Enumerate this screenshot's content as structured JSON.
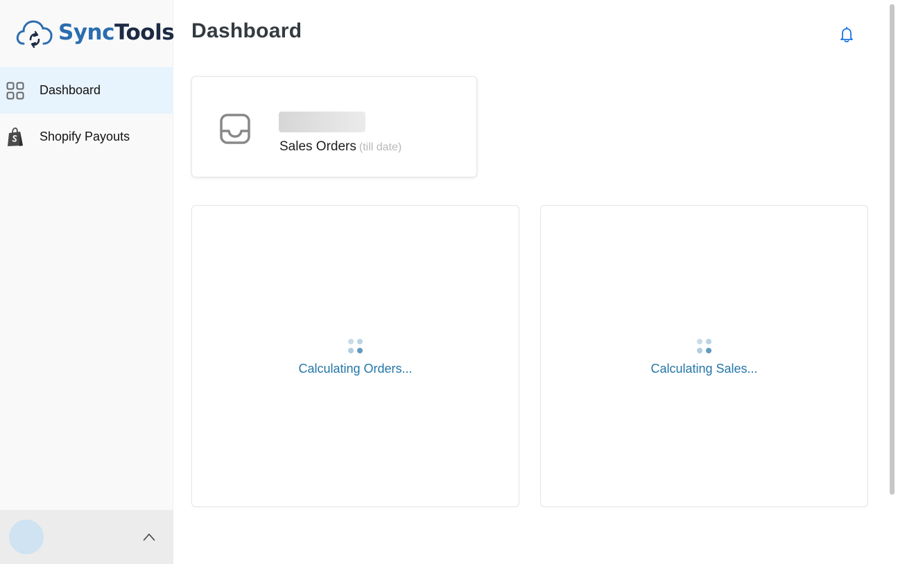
{
  "app": {
    "logo": {
      "text_sync": "Sync",
      "text_tools": "Tools",
      "icon": "cloud-sync-icon"
    }
  },
  "sidebar": {
    "items": [
      {
        "label": "Dashboard",
        "icon": "grid-icon",
        "active": true
      },
      {
        "label": "Shopify Payouts",
        "icon": "shopify-bag-icon",
        "active": false
      }
    ],
    "footer": {
      "avatar": "avatar",
      "toggle_icon": "chevron-up-icon"
    }
  },
  "header": {
    "title": "Dashboard",
    "notification_icon": "bell-icon"
  },
  "stats": {
    "sales_orders": {
      "icon": "inbox-icon",
      "label": "Sales Orders",
      "sub_label": "(till date)"
    }
  },
  "panels": {
    "orders": {
      "loading_text": "Calculating Orders..."
    },
    "sales": {
      "loading_text": "Calculating Sales..."
    }
  },
  "colors": {
    "accent": "#2a6db0",
    "active_nav_bg": "#e7f3fd",
    "loader_text": "#2476a8",
    "bell": "#1a73e8"
  }
}
